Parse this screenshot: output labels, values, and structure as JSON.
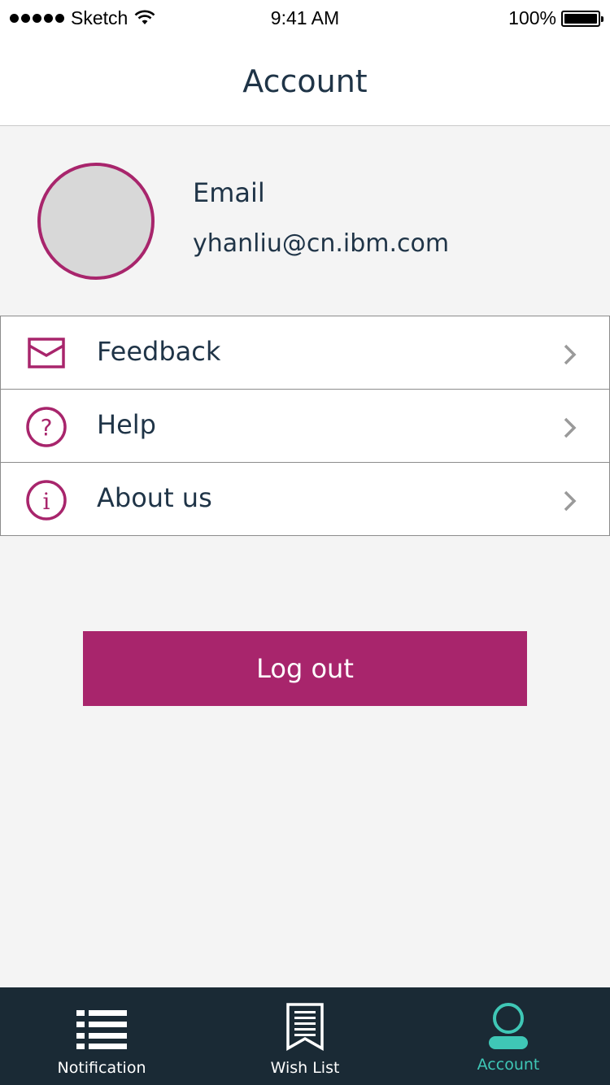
{
  "status_bar": {
    "carrier": "Sketch",
    "time": "9:41 AM",
    "battery": "100%"
  },
  "nav": {
    "title": "Account"
  },
  "profile": {
    "email_label": "Email",
    "email_value": "yhanliu@cn.ibm.com"
  },
  "menu": {
    "items": [
      {
        "label": "Feedback",
        "icon": "envelope-icon"
      },
      {
        "label": "Help",
        "icon": "question-icon"
      },
      {
        "label": "About us",
        "icon": "info-icon"
      }
    ]
  },
  "logout": {
    "label": "Log out"
  },
  "tab_bar": {
    "tabs": [
      {
        "label": "Notification",
        "icon": "list-icon",
        "active": false
      },
      {
        "label": "Wish List",
        "icon": "bookmark-document-icon",
        "active": false
      },
      {
        "label": "Account",
        "icon": "person-icon",
        "active": true
      }
    ]
  },
  "colors": {
    "accent": "#a8256c",
    "tab_bar_bg": "#1a2a35",
    "tab_active": "#3fc7b6",
    "text": "#1f3447",
    "background": "#f4f4f4"
  }
}
